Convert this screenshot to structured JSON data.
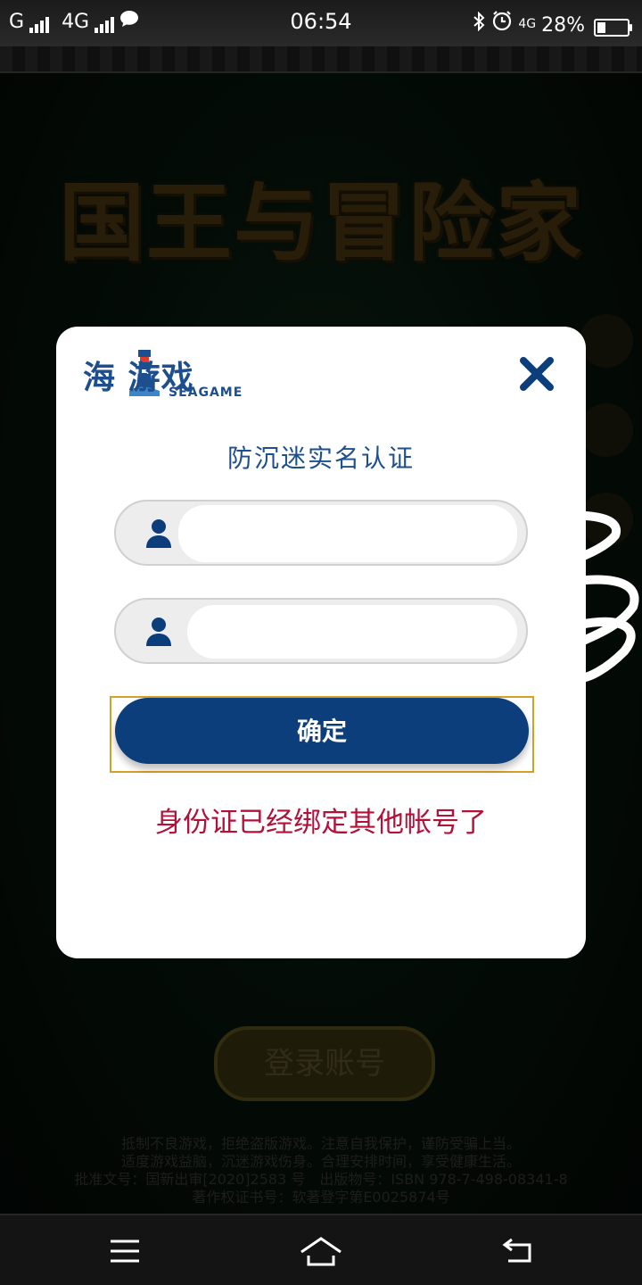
{
  "status_bar": {
    "carrier1": "G",
    "carrier2": "4G",
    "time": "06:54",
    "network_badge": "4G",
    "battery": "28%",
    "battery_level": 0.28
  },
  "game": {
    "title": "国王与冒险家",
    "login_button": "登录账号",
    "notice_lines": [
      "抵制不良游戏，拒绝盗版游戏。注意自我保护，谨防受骗上当。",
      "适度游戏益脑，沉迷游戏伤身。合理安排时间，享受健康生活。",
      "批准文号：国新出审[2020]2583 号　出版物号：ISBN 978-7-498-08341-8",
      "著作权证书号：软著登字第E0025874号"
    ]
  },
  "modal": {
    "logo_cn": "海 游戏",
    "logo_en": "SEAGAME",
    "title": "防沉迷实名认证",
    "field1_value": "",
    "field2_value": "",
    "confirm_label": "确定",
    "error_message": "身份证已经绑定其他帐号了",
    "accent_color": "#0b3e7a",
    "error_color": "#b0123a"
  },
  "icons": {
    "close": "close-icon",
    "user": "user-icon",
    "menu": "menu-icon",
    "home": "home-icon",
    "back": "back-icon"
  }
}
